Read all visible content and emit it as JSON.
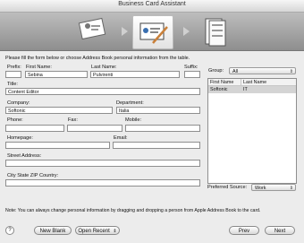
{
  "window": {
    "title": "Business Card Assistant"
  },
  "banner": {
    "steps": [
      {
        "icon": "contact-card-icon"
      },
      {
        "icon": "pen-card-icon"
      },
      {
        "icon": "print-cards-icon"
      }
    ]
  },
  "form": {
    "instructions": "Please fill the form below or choose Address Book personal information from the table.",
    "prefix": {
      "label": "Prefix:",
      "value": ""
    },
    "first_name": {
      "label": "First Name:",
      "value": "Sebina"
    },
    "last_name": {
      "label": "Last Name:",
      "value": "Pulvirenti"
    },
    "suffix": {
      "label": "Suffix:",
      "value": ""
    },
    "title": {
      "label": "Title:",
      "value": "Content Editor"
    },
    "company": {
      "label": "Company:",
      "value": "Softonic"
    },
    "department": {
      "label": "Department:",
      "value": "Italia"
    },
    "phone": {
      "label": "Phone:",
      "value": ""
    },
    "fax": {
      "label": "Fax:",
      "value": ""
    },
    "mobile": {
      "label": "Mobile:",
      "value": ""
    },
    "homepage": {
      "label": "Homepage:",
      "value": ""
    },
    "email": {
      "label": "Email:",
      "value": ""
    },
    "street_address": {
      "label": "Street Address:",
      "value": ""
    },
    "city_state_zip": {
      "label": "City State ZIP Country:",
      "value": ""
    }
  },
  "address_book": {
    "group_label": "Group:",
    "group_value": "All",
    "columns": [
      "First Name",
      "Last Name"
    ],
    "rows": [
      [
        "Softonic",
        "IT"
      ]
    ],
    "preferred_source_label": "Preferred Source:",
    "preferred_source_value": "Work"
  },
  "footer": {
    "note": "Note: You can always change personal information by dragging and dropping a person from Apple Address Book to the card.",
    "help": "?",
    "new_blank": "New Blank",
    "open_recent": "Open Recent",
    "prev": "Prev",
    "next": "Next"
  }
}
